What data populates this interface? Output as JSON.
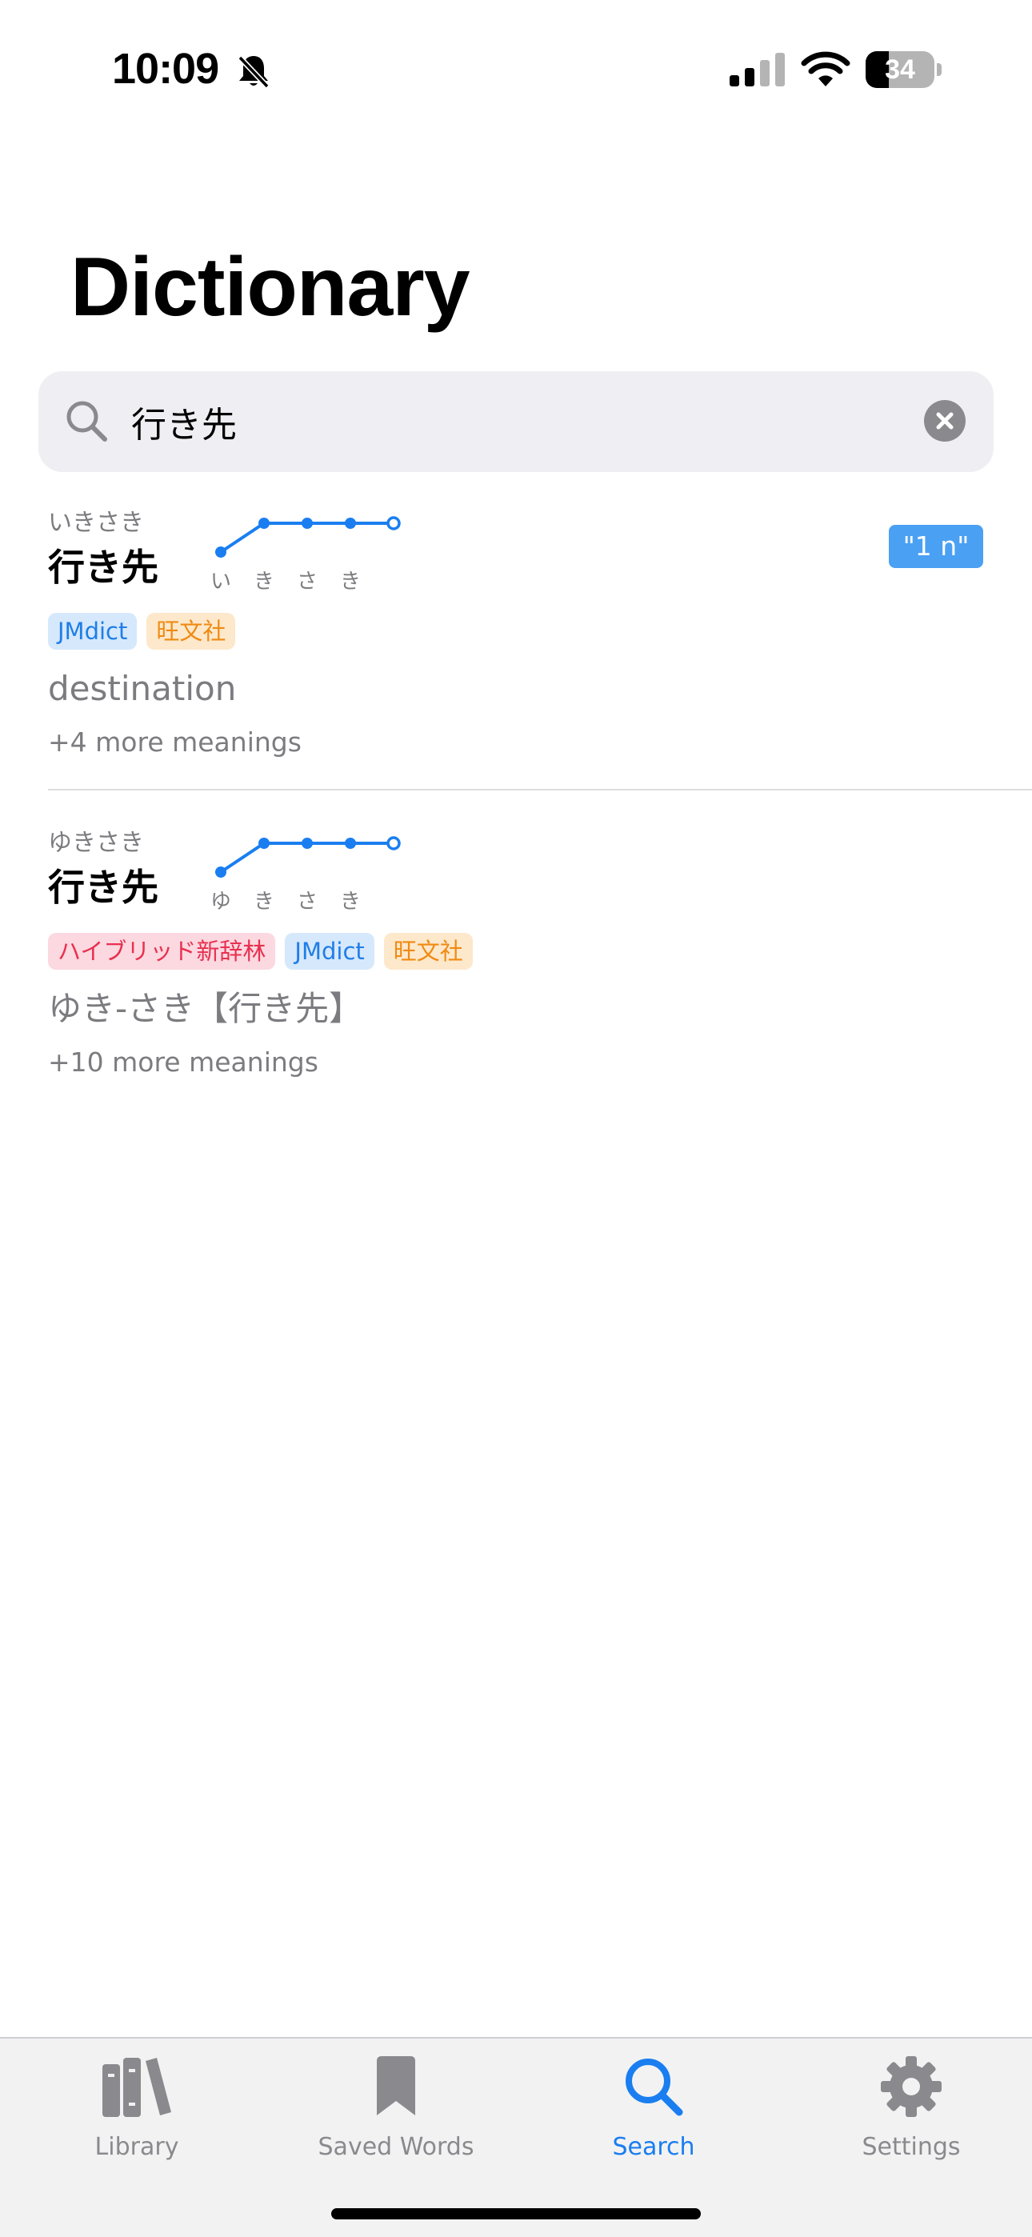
{
  "status_bar": {
    "time": "10:09",
    "battery_level": "34",
    "icons": [
      "bell-slash-icon",
      "cellular-signal-icon",
      "wifi-icon",
      "battery-icon"
    ]
  },
  "page_title": "Dictionary",
  "search": {
    "value": "行き先",
    "icon": "magnifying-glass-icon",
    "clear_icon": "xmark-circle-icon"
  },
  "results": [
    {
      "reading": "いきさき",
      "headword": "行き先",
      "pitch": {
        "morae": [
          "い",
          "き",
          "さ",
          "き"
        ],
        "levels": [
          "low",
          "high",
          "high",
          "high",
          "high"
        ]
      },
      "tags": [
        "JMdict",
        "旺文社"
      ],
      "meaning": "destination",
      "more_meanings": "+4 more meanings",
      "badge": "\"1 n\""
    },
    {
      "reading": "ゆきさき",
      "headword": "行き先",
      "pitch": {
        "morae": [
          "ゆ",
          "き",
          "さ",
          "き"
        ],
        "levels": [
          "low",
          "high",
          "high",
          "high",
          "high"
        ]
      },
      "tags": [
        "ハイブリッド新辞林",
        "JMdict",
        "旺文社"
      ],
      "meaning": "ゆき-さき【行き先】",
      "more_meanings": "+10 more meanings"
    }
  ],
  "tab_bar": {
    "items": [
      {
        "label": "Library",
        "icon": "books-icon",
        "active": false
      },
      {
        "label": "Saved Words",
        "icon": "bookmark-icon",
        "active": false
      },
      {
        "label": "Search",
        "icon": "magnifying-glass-icon",
        "active": true
      },
      {
        "label": "Settings",
        "icon": "gear-icon",
        "active": false
      }
    ]
  },
  "colors": {
    "accent": "#1a7ef0",
    "jmdict_tag": "#1f7ee8",
    "obunsha_tag": "#f08a12",
    "hybrid_tag": "#e8304f",
    "badge": "#4aa0f3"
  }
}
